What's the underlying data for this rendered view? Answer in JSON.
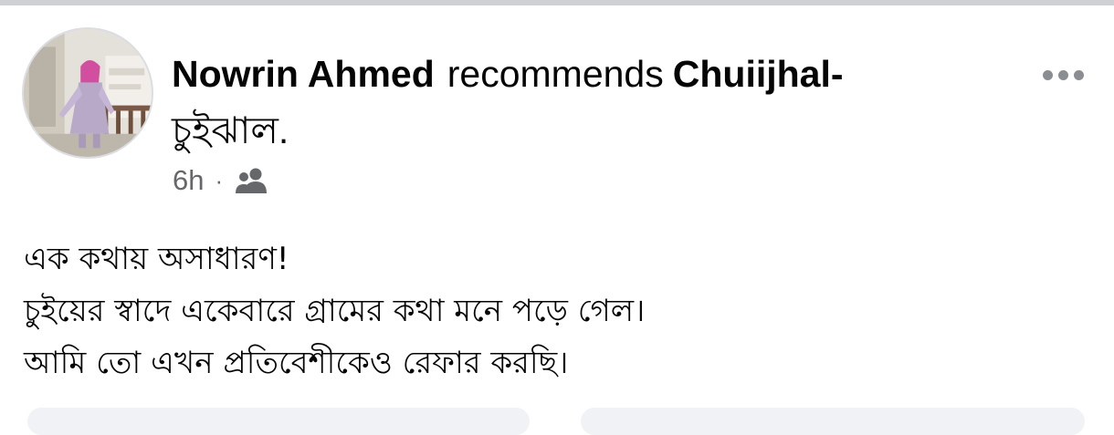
{
  "post": {
    "author_name": "Nowrin Ahmed",
    "action_text": "recommends",
    "page_name_en": "Chuiijhal-",
    "page_name_bn": "চুইঝাল",
    "page_name_suffix": ".",
    "timestamp": "6h",
    "separator": "·",
    "audience_icon": "friends-icon",
    "more_icon": "more-horizontal-icon",
    "body_lines": [
      "এক কথায় অসাধারণ!",
      "চুইয়ের স্বাদে একেবারে গ্রামের কথা মনে পড়ে গেল।",
      "আমি তো এখন প্রতিবেশীকেও রেফার করছি।"
    ]
  },
  "colors": {
    "divider": "#ced0d4",
    "secondary_text": "#65676b",
    "primary_text": "#050505",
    "icon_gray": "#8a8d91"
  }
}
